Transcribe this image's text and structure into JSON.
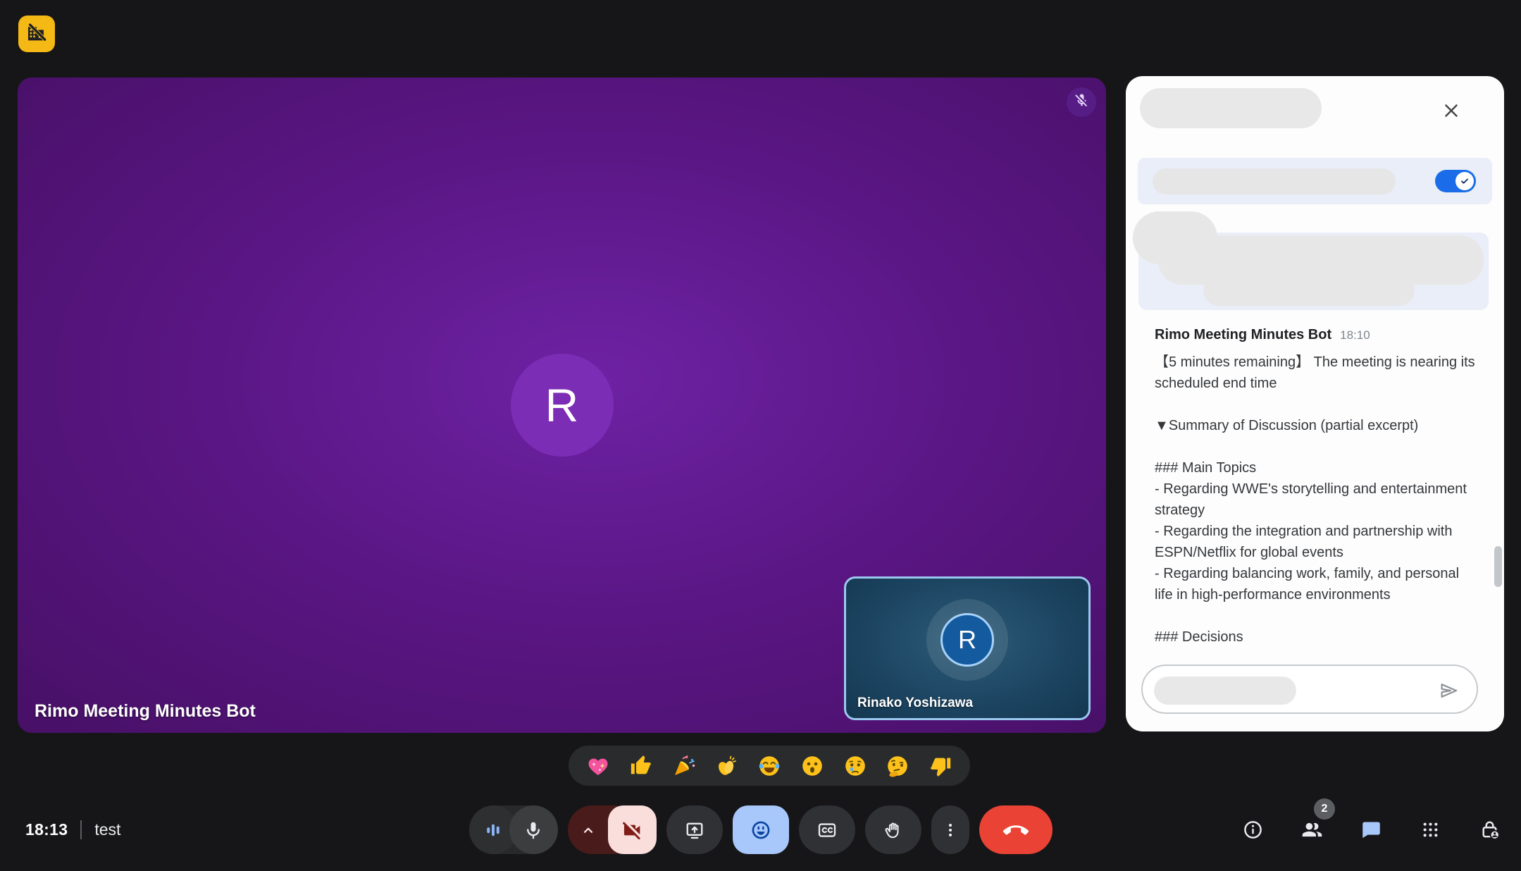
{
  "extension_badge": {
    "icon": "building-disabled-icon"
  },
  "status_bar": {
    "time": "18:13",
    "meeting_name": "test"
  },
  "main_tile": {
    "participant_name": "Rimo Meeting Minutes Bot",
    "avatar_letter": "R",
    "mic_muted": true
  },
  "pip_tile": {
    "participant_name": "Rinako Yoshizawa",
    "avatar_letter": "R",
    "speaking_highlight": true
  },
  "side_panel": {
    "toggle_on": true,
    "message": {
      "author": "Rimo Meeting Minutes Bot",
      "time": "18:10",
      "body": "【5 minutes remaining】 The meeting is nearing its scheduled end time\n\n▼Summary of Discussion (partial excerpt)\n\n### Main Topics\n- Regarding WWE's storytelling and entertainment strategy\n- Regarding the integration and partnership with ESPN/Netflix for global events\n- Regarding balancing work, family, and personal life in high-performance environments\n\n### Decisions"
    },
    "icons": {
      "close": "close-icon",
      "send": "send-icon",
      "toggle_check": "check-icon"
    }
  },
  "reactions": {
    "emojis": [
      "sparkling-heart",
      "thumbs-up",
      "party-popper",
      "clapping-hands",
      "face-with-tears-of-joy",
      "surprised-face",
      "crying-face",
      "thinking-face",
      "thumbs-down"
    ]
  },
  "toolbar": {
    "buttons": [
      "audio-level-indicator",
      "microphone",
      "video-options-chevron",
      "camera-off",
      "present-screen",
      "reactions",
      "captions",
      "raise-hand",
      "more-options",
      "end-call"
    ],
    "states": {
      "camera_off": true,
      "reactions_panel_active": true,
      "mic_on": true
    }
  },
  "right_controls": {
    "participants_count": "2",
    "buttons": [
      "meeting-details",
      "people",
      "chat",
      "activities",
      "host-controls"
    ],
    "chat_active": true
  },
  "colors": {
    "accent_toggle_blue": "#1a6ce8",
    "active_button_blue": "#a8c7fa",
    "end_call_red": "#ea4335",
    "camera_pill_maroon": "#4a1b1b",
    "camera_pill_pink": "#f9dedc",
    "tile_purple": "#5a1684",
    "pip_blue": "#1d4663",
    "panel_row_blue": "#e9eef8",
    "extension_badge_yellow": "#f5b915",
    "waveform_blue": "#8ab4f8"
  }
}
